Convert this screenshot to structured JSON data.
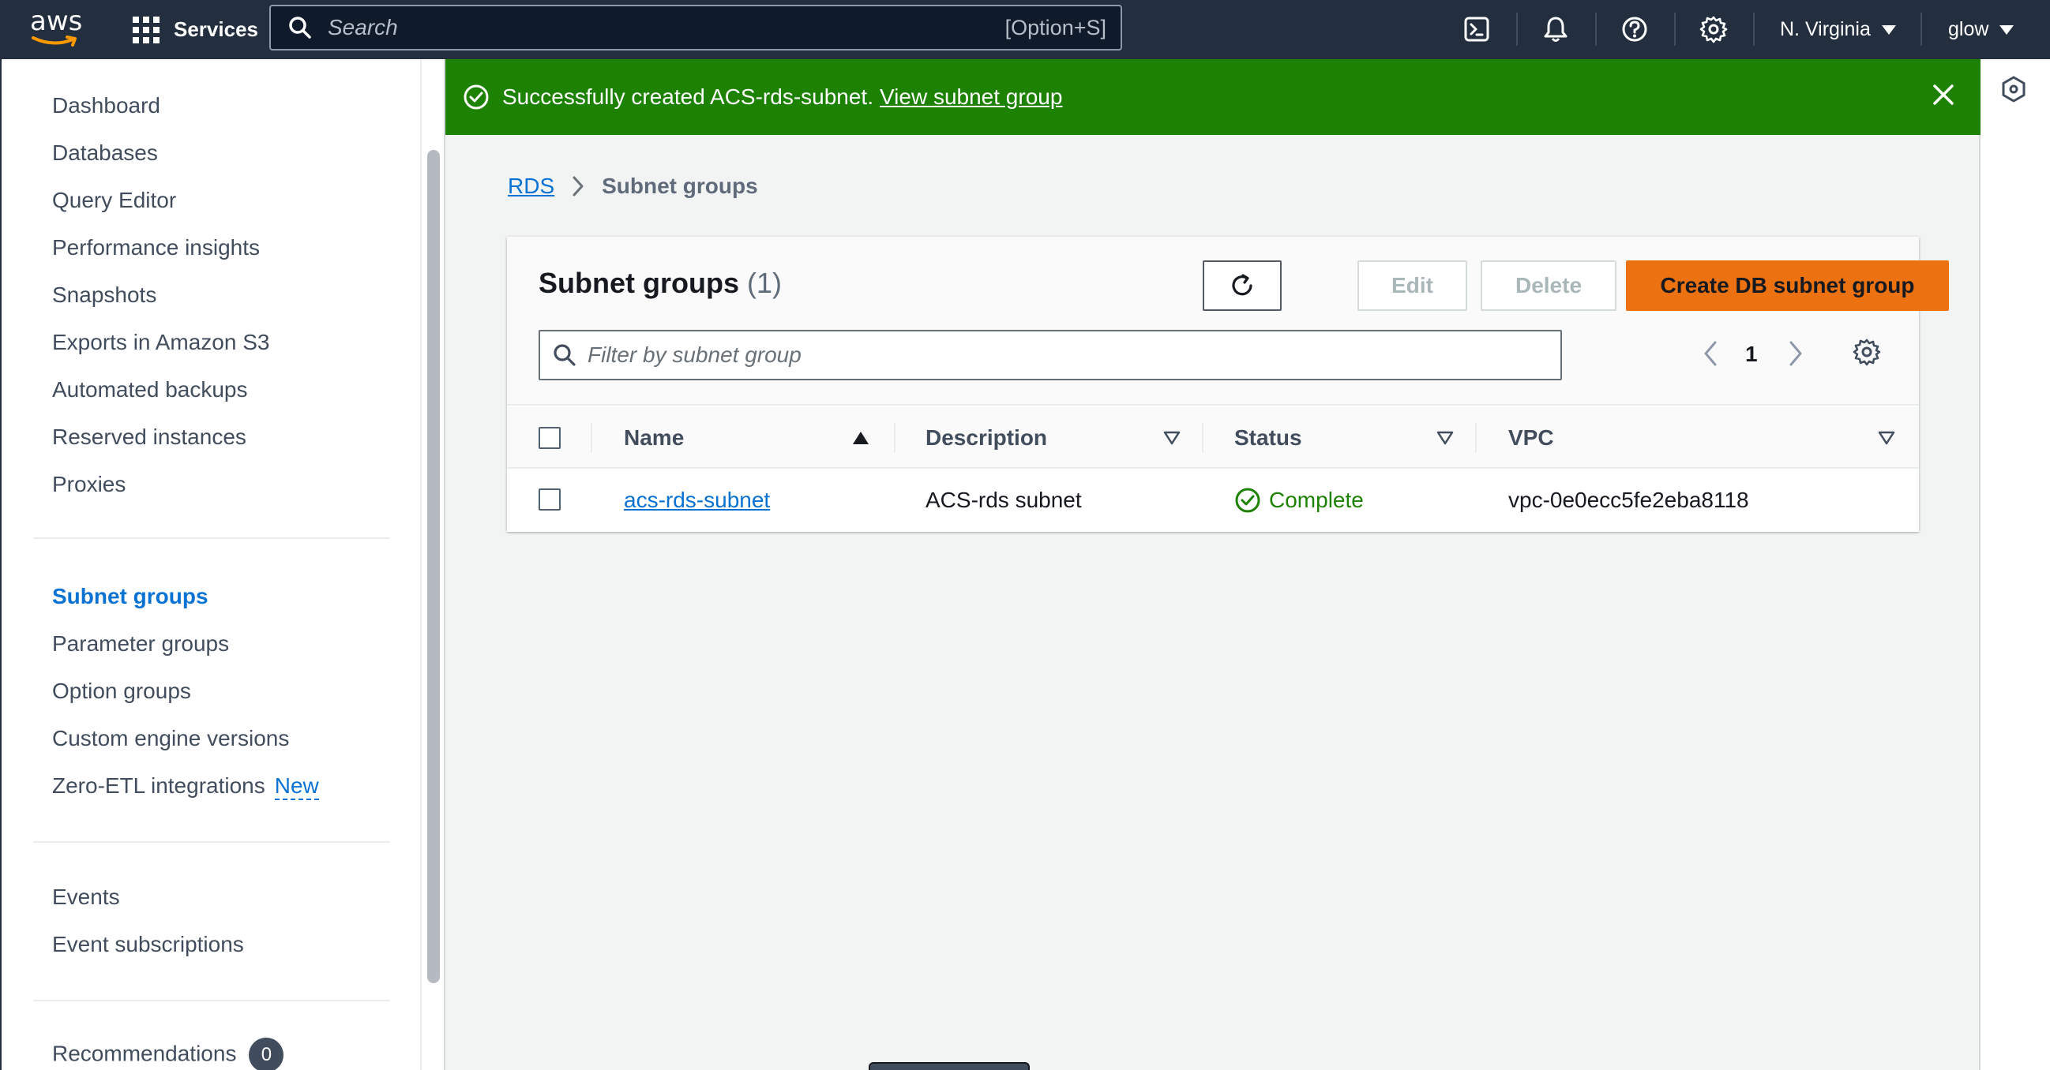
{
  "topnav": {
    "logo_text": "aws",
    "services_label": "Services",
    "search_placeholder": "Search",
    "search_shortcut": "[Option+S]",
    "icons": [
      "cloudshell-icon",
      "bell-icon",
      "help-icon",
      "gear-icon"
    ],
    "region_label": "N. Virginia",
    "user_label": "glow"
  },
  "sidebar": {
    "group1": [
      "Dashboard",
      "Databases",
      "Query Editor",
      "Performance insights",
      "Snapshots",
      "Exports in Amazon S3",
      "Automated backups",
      "Reserved instances",
      "Proxies"
    ],
    "group2": [
      "Subnet groups",
      "Parameter groups",
      "Option groups",
      "Custom engine versions",
      "Zero-ETL integrations"
    ],
    "zero_etl_tag": "New",
    "group3": [
      "Events",
      "Event subscriptions"
    ],
    "recommendations_label": "Recommendations",
    "recommendations_count": "0",
    "active_item": "Subnet groups"
  },
  "flash": {
    "message": "Successfully created ACS-rds-subnet.",
    "link": "View subnet group",
    "color": "#1d8102"
  },
  "breadcrumb": {
    "root": "RDS",
    "current": "Subnet groups"
  },
  "container": {
    "title": "Subnet groups",
    "count": "(1)",
    "edit_label": "Edit",
    "delete_label": "Delete",
    "create_label": "Create DB subnet group",
    "filter_placeholder": "Filter by subnet group",
    "page_number": "1"
  },
  "table": {
    "columns": [
      "Name",
      "Description",
      "Status",
      "VPC"
    ],
    "rows": [
      {
        "name": "acs-rds-subnet",
        "description": "ACS-rds subnet",
        "status": "Complete",
        "vpc": "vpc-0e0ecc5fe2eba8118"
      }
    ]
  },
  "colors": {
    "nav_bg": "#232f3e",
    "accent_link": "#0972d3",
    "primary_button": "#ec7211",
    "success": "#1d8102"
  }
}
